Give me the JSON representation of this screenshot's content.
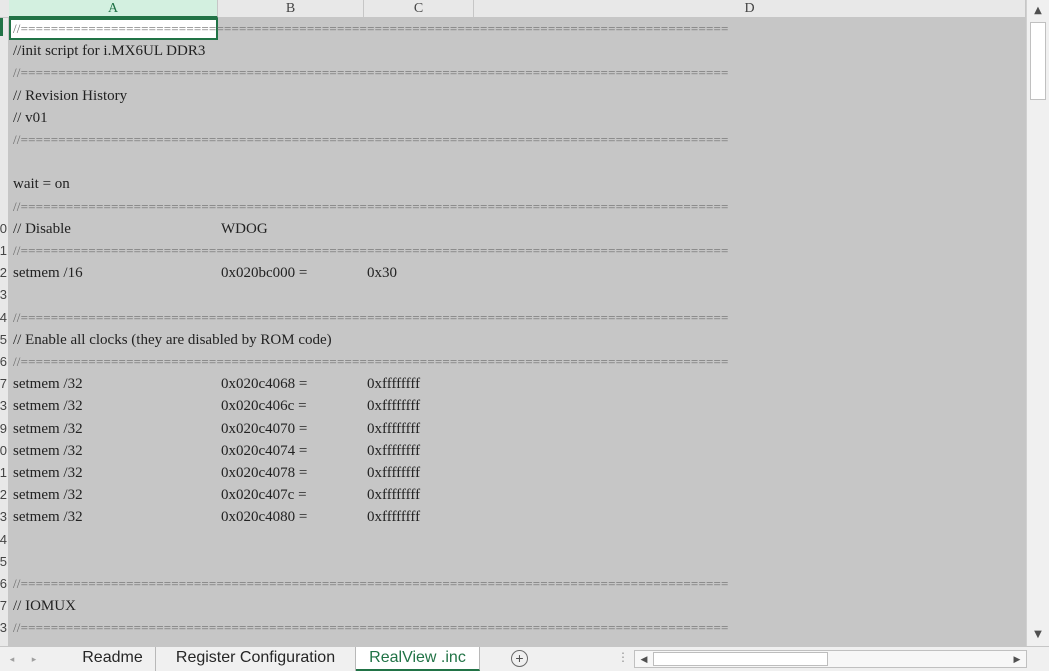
{
  "columns": [
    "A",
    "B",
    "C",
    "D"
  ],
  "row_numbers": [
    "",
    "",
    "",
    "",
    "",
    "",
    "",
    "",
    "",
    "0",
    "1",
    "2",
    "3",
    "4",
    "5",
    "6",
    "7",
    "3",
    "9",
    "0",
    "1",
    "2",
    "3",
    "4",
    "5",
    "6",
    "7",
    "3"
  ],
  "lines": [
    {
      "a": "//=============================================================================================="
    },
    {
      "a": "//init script for i.MX6UL DDR3"
    },
    {
      "a": "//=============================================================================================="
    },
    {
      "a": "// Revision History"
    },
    {
      "a": "// v01"
    },
    {
      "a": "//=============================================================================================="
    },
    {
      "a": ""
    },
    {
      "a": "wait = on"
    },
    {
      "a": "//=============================================================================================="
    },
    {
      "a": "// Disable",
      "b": "WDOG"
    },
    {
      "a": "//=============================================================================================="
    },
    {
      "a": "setmem /16",
      "b": "0x020bc000 =",
      "c": "0x30"
    },
    {
      "a": ""
    },
    {
      "a": "//=============================================================================================="
    },
    {
      "a": "// Enable all clocks (they are disabled by ROM code)"
    },
    {
      "a": "//=============================================================================================="
    },
    {
      "a": "setmem /32",
      "b": "0x020c4068 =",
      "c": "0xffffffff"
    },
    {
      "a": "setmem /32",
      "b": "0x020c406c =",
      "c": "0xffffffff"
    },
    {
      "a": "setmem /32",
      "b": "0x020c4070 =",
      "c": "0xffffffff"
    },
    {
      "a": "setmem /32",
      "b": "0x020c4074 =",
      "c": "0xffffffff"
    },
    {
      "a": "setmem /32",
      "b": "0x020c4078 =",
      "c": "0xffffffff"
    },
    {
      "a": "setmem /32",
      "b": "0x020c407c =",
      "c": "0xffffffff"
    },
    {
      "a": "setmem /32",
      "b": "0x020c4080 =",
      "c": "0xffffffff"
    },
    {
      "a": ""
    },
    {
      "a": ""
    },
    {
      "a": "//=============================================================================================="
    },
    {
      "a": "// IOMUX"
    },
    {
      "a": "//=============================================================================================="
    }
  ],
  "sheet_tabs": [
    "Readme",
    "Register Configuration",
    "RealView .inc"
  ],
  "active_sheet": "RealView .inc",
  "icons": {
    "first_sheet": "◂",
    "last_sheet": "▸",
    "add_sheet": "+",
    "scroll_up": "▲",
    "scroll_down": "▼",
    "scroll_left": "◀",
    "scroll_right": "▶",
    "more": "⋮"
  },
  "colors": {
    "accent": "#217346",
    "grid_bg": "#c6c6c6"
  }
}
